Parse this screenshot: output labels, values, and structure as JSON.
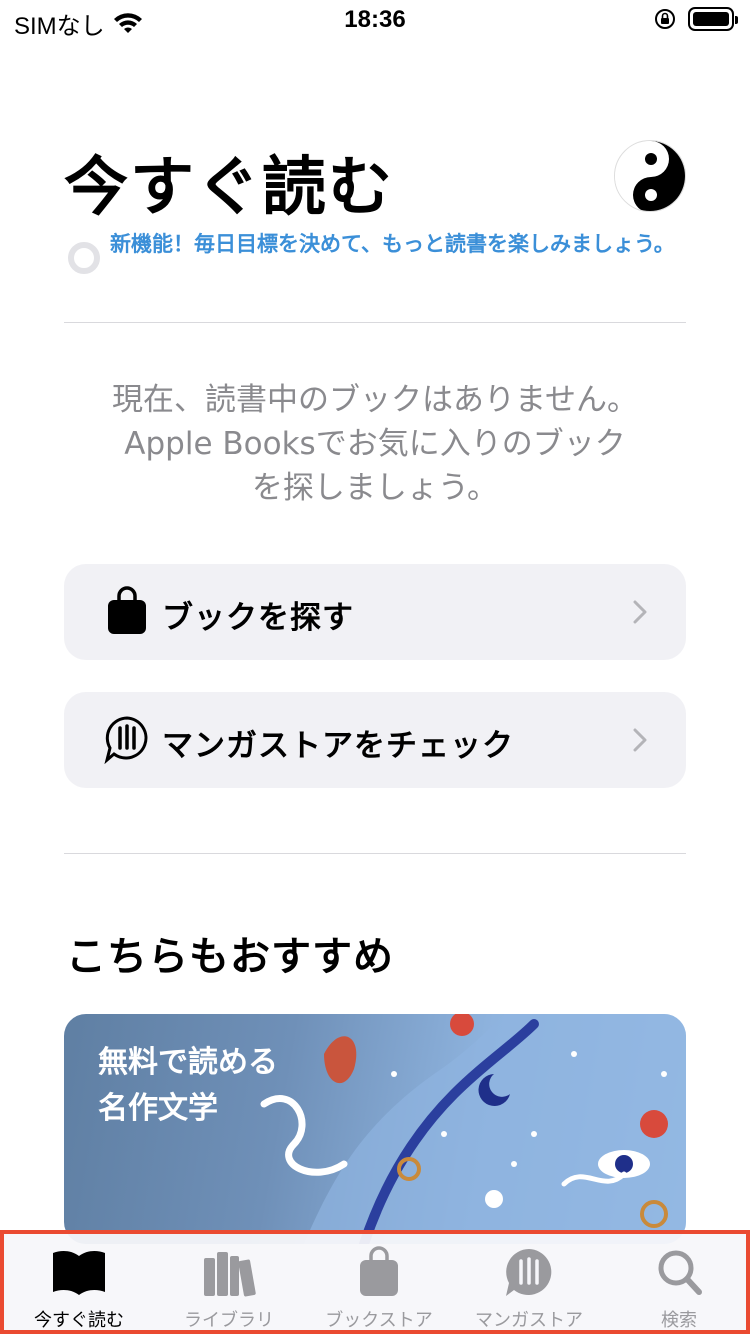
{
  "status_bar": {
    "carrier": "SIMなし",
    "time": "18:36"
  },
  "header": {
    "title": "今すぐ読む"
  },
  "goal": {
    "text": "新機能！毎日目標を決めて、もっと読書を楽しみましょう。"
  },
  "empty_state": {
    "message": "現在、読書中のブックはありません。Apple Booksでお気に入りのブックを探しましょう。"
  },
  "actions": [
    {
      "label": "ブックを探す",
      "icon": "shopping-bag-icon"
    },
    {
      "label": "マンガストアをチェック",
      "icon": "manga-bubble-icon"
    }
  ],
  "recommendations": {
    "title": "こちらもおすすめ",
    "card_title": "無料で読める\n名作文学"
  },
  "tabs": [
    {
      "label": "今すぐ読む",
      "icon": "book-open-icon",
      "active": true
    },
    {
      "label": "ライブラリ",
      "icon": "library-icon",
      "active": false
    },
    {
      "label": "ブックストア",
      "icon": "bag-icon",
      "active": false
    },
    {
      "label": "マンガストア",
      "icon": "manga-icon",
      "active": false
    },
    {
      "label": "検索",
      "icon": "search-icon",
      "active": false
    }
  ],
  "colors": {
    "accent": "#3b8fd8",
    "highlight_border": "#ea4a31",
    "button_bg": "#f1f1f5",
    "inactive": "#9a9a9e"
  }
}
